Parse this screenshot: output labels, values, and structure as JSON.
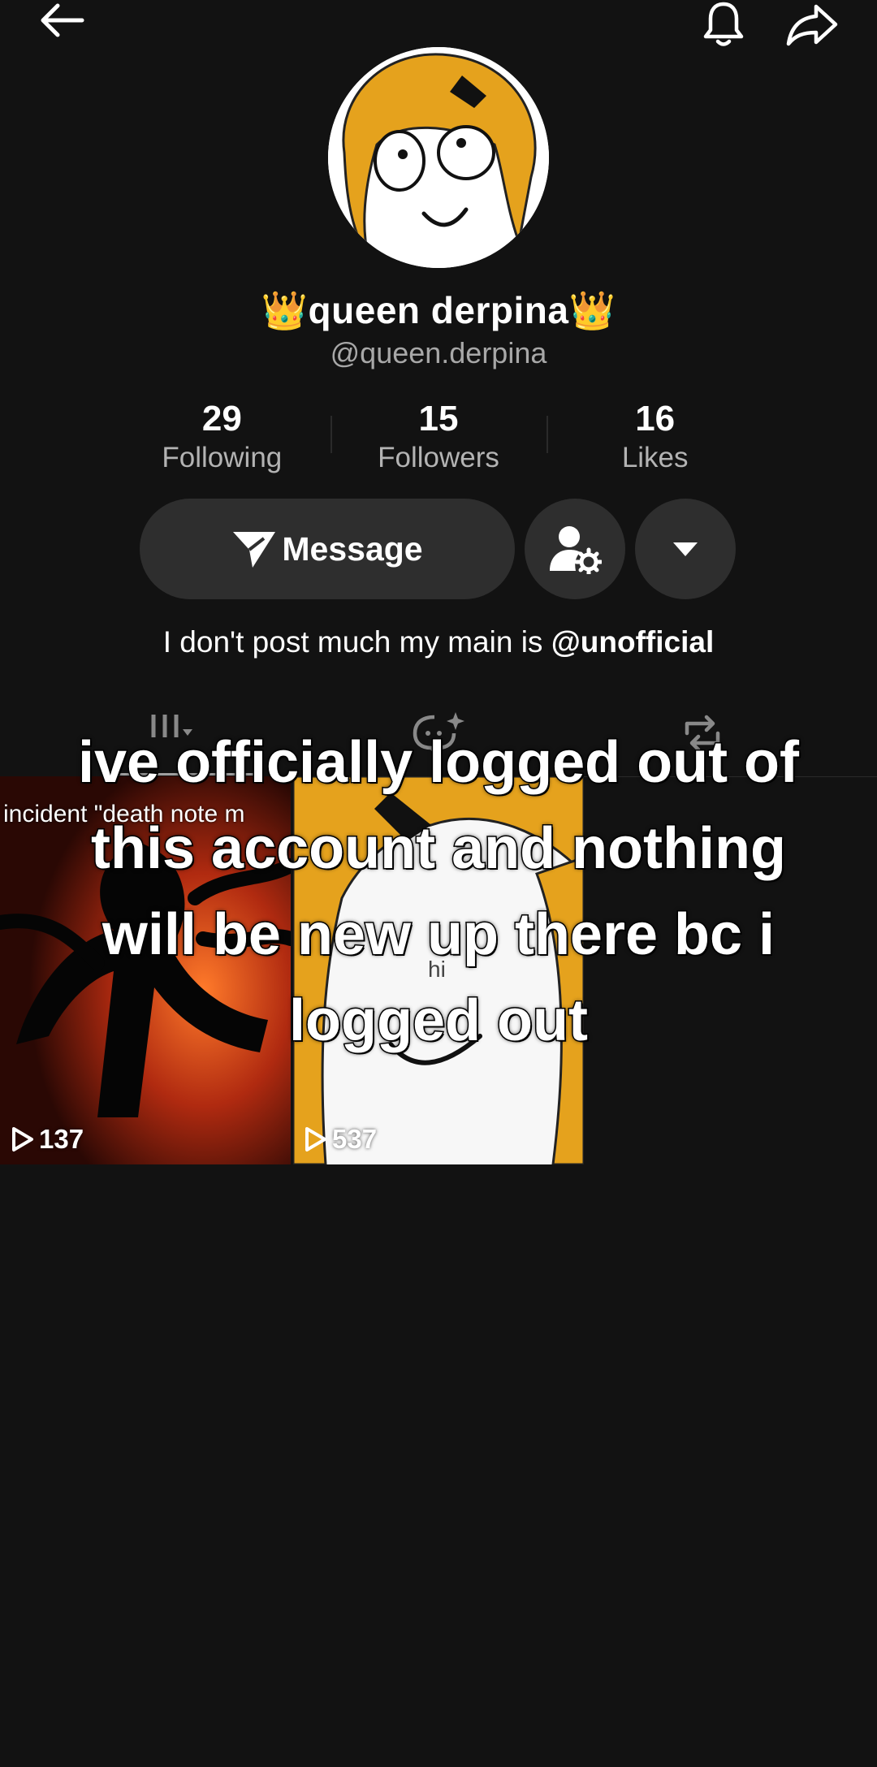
{
  "header": {
    "back_icon": "arrow-left-icon",
    "notification_icon": "bell-icon",
    "share_icon": "share-arrow-icon"
  },
  "profile": {
    "display_name": "👑queen derpina👑",
    "username": "@queen.derpina",
    "bio_prefix": "I don't post much my main is ",
    "bio_mention": "@unofficial"
  },
  "stats": [
    {
      "value": "29",
      "label": "Following"
    },
    {
      "value": "15",
      "label": "Followers"
    },
    {
      "value": "16",
      "label": "Likes"
    }
  ],
  "actions": {
    "message_label": "Message",
    "message_icon": "send-icon",
    "friend_icon": "person-gear-icon",
    "more_icon": "caret-down-icon"
  },
  "tabs": [
    {
      "icon": "grid-videos-icon"
    },
    {
      "icon": "ai-chat-sparkle-icon"
    },
    {
      "icon": "repost-icon"
    }
  ],
  "videos": [
    {
      "caption": "incident \"death note m",
      "views": "137"
    },
    {
      "caption": "hi",
      "views": "537"
    }
  ],
  "overlay_text": "ive officially logged out of this account and nothing will be new up there bc i logged out",
  "colors": {
    "background": "#121212",
    "button_bg": "#2e2e2e",
    "muted_text": "#a8a8a8"
  }
}
